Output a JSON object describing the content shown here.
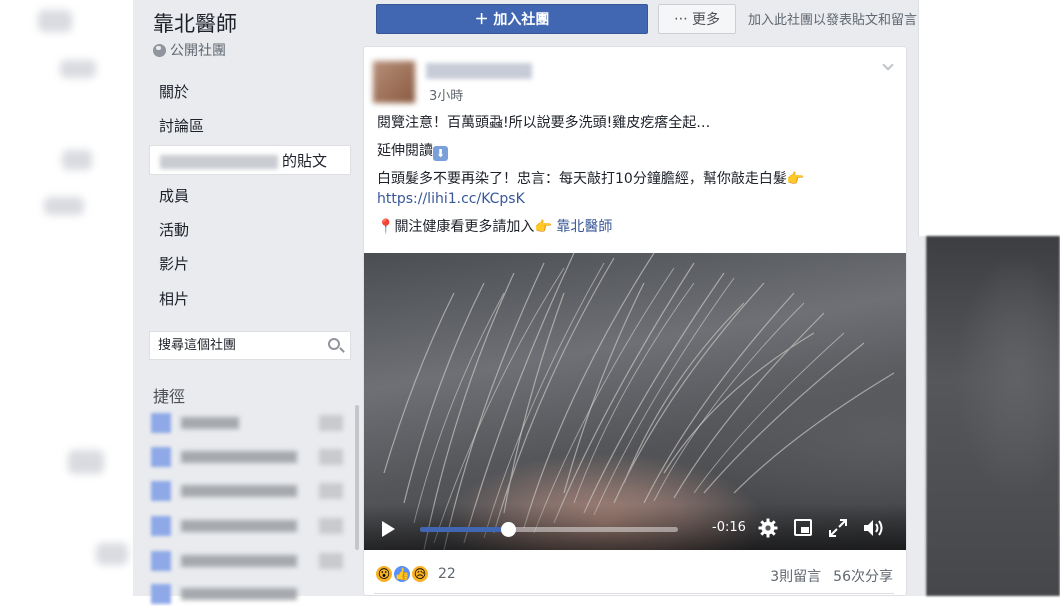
{
  "sidebar": {
    "group_name": "靠北醫師",
    "group_type": "公開社團",
    "nav": [
      {
        "label": "關於"
      },
      {
        "label": "討論區"
      },
      {
        "label": "的貼文"
      },
      {
        "label": "成員"
      },
      {
        "label": "活動"
      },
      {
        "label": "影片"
      },
      {
        "label": "相片"
      }
    ],
    "search_placeholder": "搜尋這個社團",
    "shortcuts_heading": "捷徑"
  },
  "actions": {
    "join_label": "＋ 加入社團",
    "more_label": "更多",
    "more_prefix": "⋯",
    "join_hint": "加入此社團以發表貼文和留言"
  },
  "post": {
    "time": "3小時",
    "line1": "閱覽注意！百萬頭蝨!所以說要多洗頭!雞皮疙瘩全起…",
    "read_more": "延伸閱讀",
    "read_more_emoji": "⬇",
    "line2": "白頭髮多不要再染了！忠言：每天敲打10分鐘膽經，幫你敲走白髮",
    "pointing_emoji": "👉",
    "link": "https://lihi1.cc/KCpsK",
    "follow_prefix": "📍",
    "follow_text": "關注健康看更多請加入",
    "follow_group": "靠北醫師",
    "video": {
      "progress": 0.34,
      "time_remaining": "-0:16"
    },
    "reactions": {
      "wow": "😮",
      "like": "👍",
      "sad": "😥",
      "count": "22"
    },
    "comments": "3則留言",
    "shares": "56次分享"
  },
  "colors": {
    "facebook_blue": "#4267b2",
    "link_blue": "#385898",
    "sidebar_bg": "#e9ebee"
  }
}
